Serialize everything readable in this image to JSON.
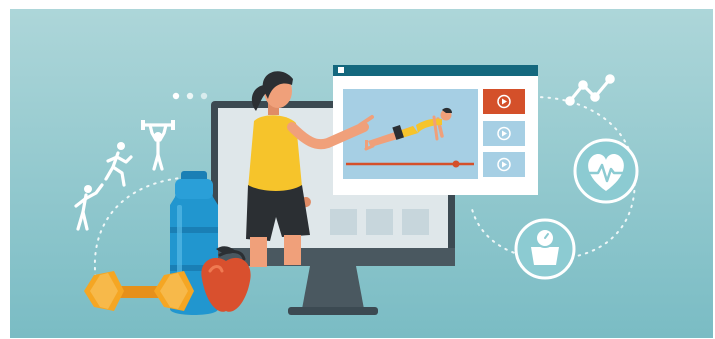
{
  "scene": {
    "colors": {
      "bg_light": "#a9d4d8",
      "bg_dark": "#7dbfc6",
      "monitor": "#3c4a52",
      "monitor_screen": "#dfe7ea",
      "window_bar": "#14687e",
      "accent": "#d4502a",
      "video_thumb": "#a6cfe4",
      "video_thumb_active": "#d4502a",
      "bottle": "#2196cf",
      "dumbbell": "#f5a623",
      "apple": "#d9502e",
      "trainer_shirt": "#f6c42b",
      "trainer_shorts": "#2b2f33",
      "skin": "#f0a07a",
      "icon_line": "#ffffff"
    },
    "icons": [
      "stretching-person-icon",
      "running-person-icon",
      "weightlifting-person-icon",
      "heart-rate-icon",
      "bathroom-scale-icon",
      "line-graph-icon"
    ]
  }
}
